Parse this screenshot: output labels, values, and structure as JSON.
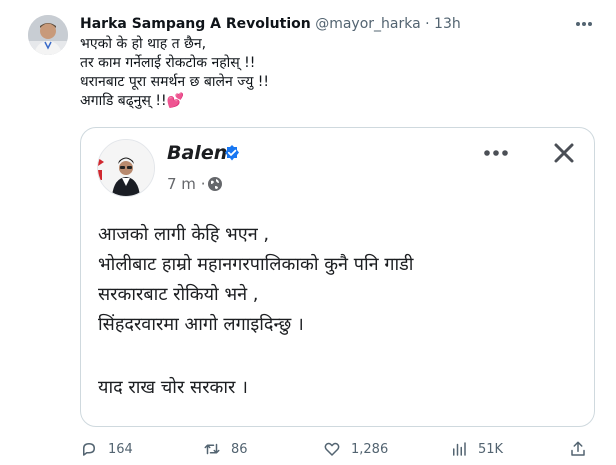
{
  "tweet": {
    "author_name": "Harka Sampang A Revolution",
    "handle": "@mayor_harka",
    "separator": "·",
    "time": "13h",
    "text_lines": [
      "भएको के हो थाह त छैन,",
      "तर काम गर्नेलाई रोकटोक नहोस् !!",
      "धरानबाट पूरा समर्थन छ बालेन ज्यु !!",
      "अगाडि बढ्नुस् !!"
    ],
    "heart_emoji": "💕"
  },
  "quoted_post": {
    "author": "Balen",
    "time": "7 m",
    "separator": "·",
    "text_lines": [
      "आजको लागी केहि भएन ,",
      "भोलीबाट हाम्रो महानगरपालिकाको कुनै पनि गाडी",
      "सरकारबाट रोकियो भने ,",
      "सिंहदरवारमा आगो लगाइदिन्छु ।"
    ],
    "final_line": "याद राख चोर सरकार ।"
  },
  "actions": {
    "replies": "164",
    "retweets": "86",
    "likes": "1,286",
    "views": "51K"
  },
  "colors": {
    "verified_blue": "#1877f2",
    "muted_text": "#536471",
    "card_border": "#cfd9de"
  },
  "icons": [
    "more-horizontal-icon",
    "verified-badge-icon",
    "globe-icon",
    "close-icon",
    "reply-icon",
    "retweet-icon",
    "like-icon",
    "views-icon",
    "share-icon"
  ]
}
